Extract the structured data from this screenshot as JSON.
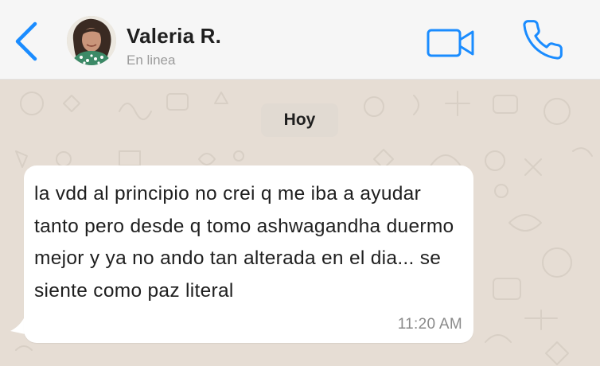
{
  "header": {
    "back_icon": "chevron-left-icon",
    "contact_name": "Valeria R.",
    "status": "En linea",
    "video_icon": "video-camera-icon",
    "call_icon": "phone-icon",
    "accent_color": "#1a8cff"
  },
  "chat": {
    "date_label": "Hoy",
    "messages": [
      {
        "direction": "incoming",
        "text": "la vdd al principio no crei q me iba a ayudar tanto pero desde q tomo ashwagandha duermo mejor y ya no ando tan alterada en el dia... se siente como paz literal",
        "time": "11:20 AM"
      }
    ]
  }
}
